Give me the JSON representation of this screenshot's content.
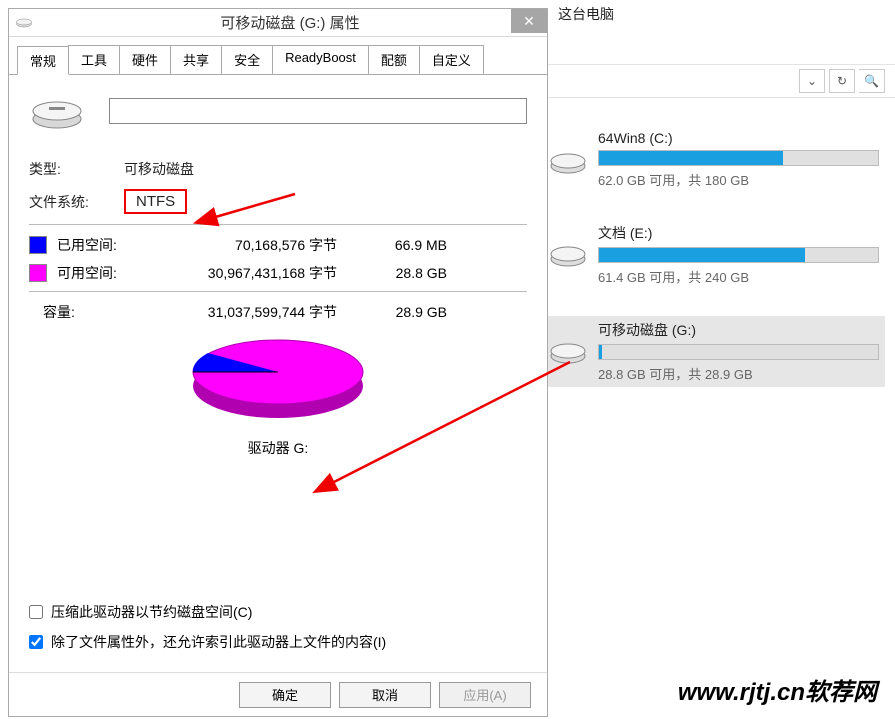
{
  "dialog": {
    "title": "可移动磁盘 (G:) 属性",
    "tabs": [
      "常规",
      "工具",
      "硬件",
      "共享",
      "安全",
      "ReadyBoost",
      "配额",
      "自定义"
    ],
    "name_value": "",
    "type_label": "类型:",
    "type_value": "可移动磁盘",
    "fs_label": "文件系统:",
    "fs_value": "NTFS",
    "used": {
      "label": "已用空间:",
      "bytes": "70,168,576 字节",
      "pretty": "66.9 MB",
      "color": "#0000ff"
    },
    "free": {
      "label": "可用空间:",
      "bytes": "30,967,431,168 字节",
      "pretty": "28.8 GB",
      "color": "#ff00ff"
    },
    "capacity": {
      "label": "容量:",
      "bytes": "31,037,599,744 字节",
      "pretty": "28.9 GB"
    },
    "drive_label": "驱动器 G:",
    "compress_label": "压缩此驱动器以节约磁盘空间(C)",
    "index_label": "除了文件属性外，还允许索引此驱动器上文件的内容(I)",
    "buttons": {
      "ok": "确定",
      "cancel": "取消",
      "apply": "应用(A)"
    }
  },
  "explorer": {
    "title": "这台电脑",
    "drives": [
      {
        "name": "64Win8 (C:)",
        "stats": "62.0 GB 可用，共 180 GB",
        "fill_pct": 66
      },
      {
        "name": "文档 (E:)",
        "stats": "61.4 GB 可用，共 240 GB",
        "fill_pct": 74
      },
      {
        "name": "可移动磁盘 (G:)",
        "stats": "28.8 GB 可用，共 28.9 GB",
        "fill_pct": 1
      }
    ]
  },
  "chart_data": {
    "type": "pie",
    "title": "驱动器 G:",
    "series": [
      {
        "name": "已用空间",
        "value": 70168576,
        "pretty": "66.9 MB",
        "color": "#0000ff"
      },
      {
        "name": "可用空间",
        "value": 30967431168,
        "pretty": "28.8 GB",
        "color": "#ff00ff"
      }
    ],
    "total": {
      "value": 31037599744,
      "pretty": "28.9 GB"
    }
  },
  "watermark": "www.rjtj.cn软荐网"
}
